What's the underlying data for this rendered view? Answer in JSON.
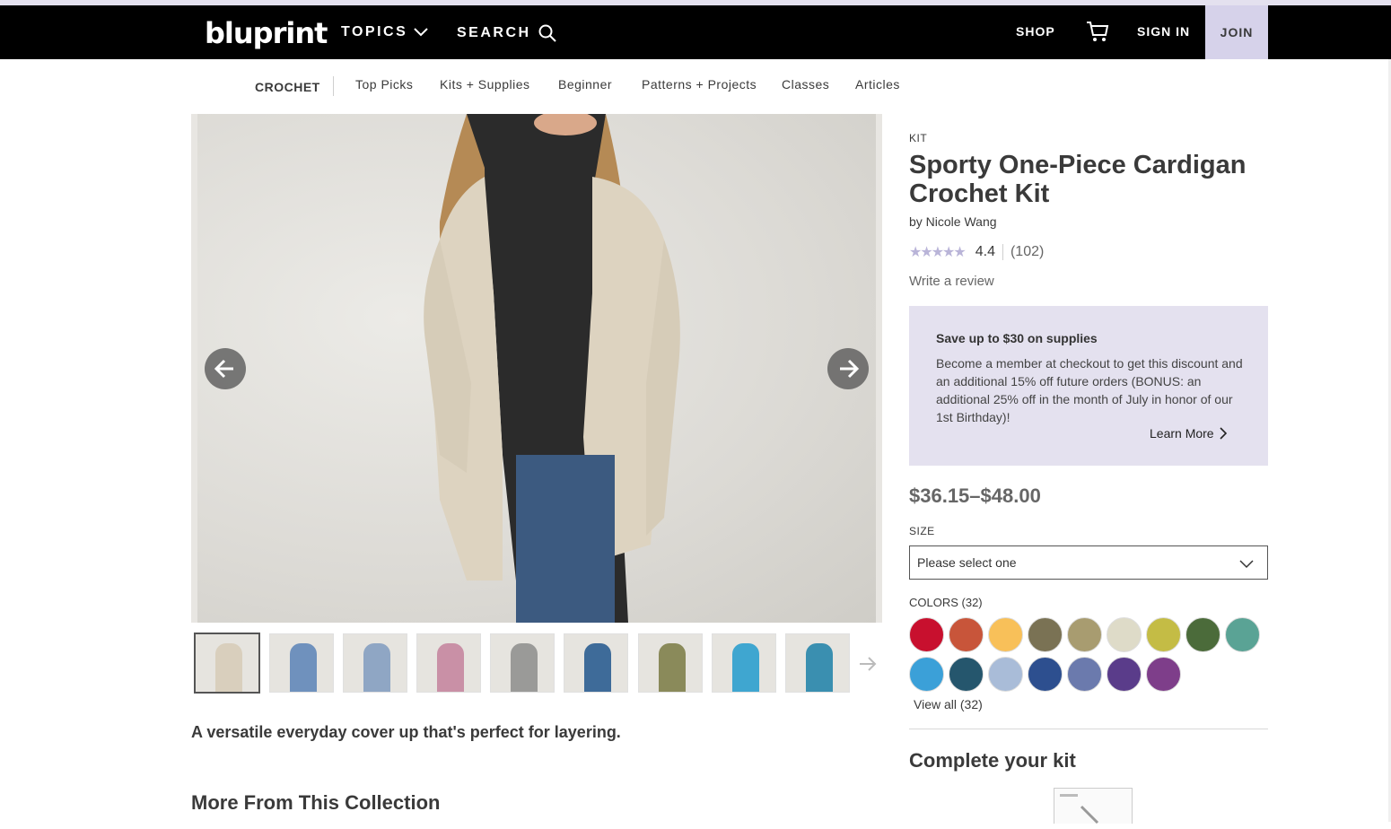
{
  "header": {
    "logo": "bluprint",
    "topics": "TOPICS",
    "search": "SEARCH",
    "shop": "SHOP",
    "sign_in": "SIGN IN",
    "join": "JOIN"
  },
  "subnav": {
    "category": "CROCHET",
    "items": [
      "Top Picks",
      "Kits + Supplies",
      "Beginner",
      "Patterns + Projects",
      "Classes",
      "Articles"
    ]
  },
  "product": {
    "type": "KIT",
    "title": "Sporty One-Piece Cardigan Crochet Kit",
    "author": "by Nicole Wang",
    "rating": "4.4",
    "rating_value": 4.4,
    "review_count": "(102)",
    "write_review": "Write a review",
    "tagline": "A versatile everyday cover up that's perfect for layering.",
    "price": "$36.15–$48.00"
  },
  "promo": {
    "heading": "Save up to $30 on supplies",
    "body": "Become a member at checkout to get this discount and an additional 15% off future orders (BONUS: an additional 25% off in the month of July in honor of our 1st Birthday)!",
    "link": "Learn More"
  },
  "size": {
    "label": "SIZE",
    "placeholder": "Please select one"
  },
  "colors": {
    "label": "COLORS (32)",
    "view_all": "View all (32)",
    "swatches": [
      "#c8102e",
      "#c8553a",
      "#f8c059",
      "#7a7254",
      "#a89c70",
      "#dedbc8",
      "#c4bc45",
      "#4b6b3a",
      "#5aa395",
      "#3ba0d8",
      "#25566d",
      "#a9bcd8",
      "#2d4f8f",
      "#6b7aad",
      "#5a3c8a",
      "#7e3e8a"
    ]
  },
  "thumbnails": {
    "colors": [
      "#d9cfbd",
      "#6f91bd",
      "#8fa6c4",
      "#c990a6",
      "#9a9a98",
      "#3e6b99",
      "#8a8a5a",
      "#3fa6d0",
      "#3a8fb0"
    ]
  },
  "sections": {
    "more_from_collection": "More From This Collection",
    "complete_kit": "Complete your kit"
  }
}
